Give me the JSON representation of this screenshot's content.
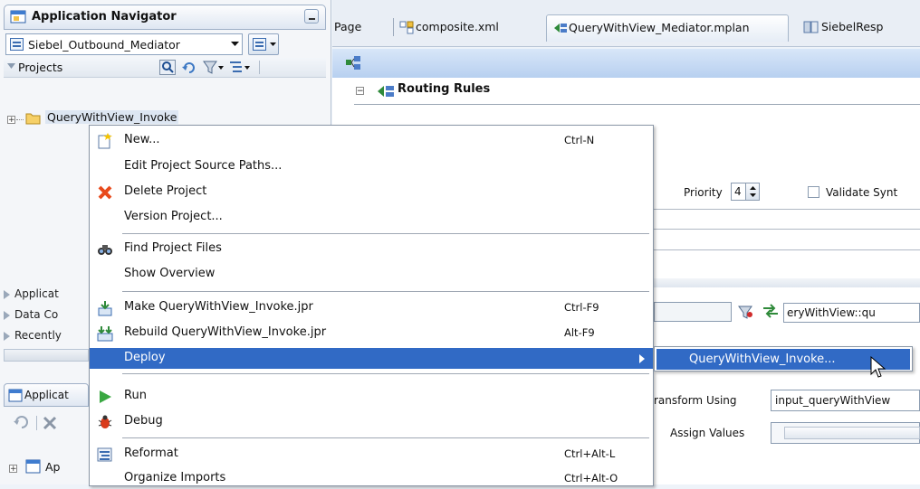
{
  "navigator": {
    "title": "Application Navigator",
    "project_selector": "Siebel_Outbound_Mediator",
    "projects_label": "Projects",
    "tree_item": "QueryWithView_Invoke",
    "accordions": [
      "Applicat",
      "Data Co",
      "Recently"
    ],
    "second_panel_title": "Applicat",
    "second_tree_item": "Ap"
  },
  "tabs": [
    {
      "label": "Page"
    },
    {
      "label": "composite.xml"
    },
    {
      "label": "QueryWithView_Mediator.mplan"
    },
    {
      "label": "SiebelResp"
    }
  ],
  "editor": {
    "routing_rules": "Routing Rules",
    "priority_label": "Priority",
    "priority_value": "4",
    "validate_label": "Validate Synt",
    "filter_value": "eryWithView::qu",
    "transform_label": "ransform Using",
    "transform_value": "input_queryWithView",
    "assign_label": "Assign Values"
  },
  "context_menu": {
    "items": [
      {
        "label": "New...",
        "shortcut": "Ctrl-N",
        "icon": "new-icon"
      },
      {
        "label": "Edit Project Source Paths...",
        "shortcut": "",
        "icon": ""
      },
      {
        "label": "Delete Project",
        "shortcut": "",
        "icon": "delete-icon"
      },
      {
        "label": "Version Project...",
        "shortcut": "",
        "icon": ""
      },
      {
        "label": "Find Project Files",
        "shortcut": "",
        "icon": "binoculars-icon"
      },
      {
        "label": "Show Overview",
        "shortcut": "",
        "icon": ""
      },
      {
        "label": "Make QueryWithView_Invoke.jpr",
        "shortcut": "Ctrl-F9",
        "icon": "make-icon"
      },
      {
        "label": "Rebuild QueryWithView_Invoke.jpr",
        "shortcut": "Alt-F9",
        "icon": "rebuild-icon"
      },
      {
        "label": "Deploy",
        "shortcut": "",
        "icon": ""
      },
      {
        "label": "Run",
        "shortcut": "",
        "icon": "run-icon"
      },
      {
        "label": "Debug",
        "shortcut": "",
        "icon": "debug-icon"
      },
      {
        "label": "Reformat",
        "shortcut": "Ctrl+Alt-L",
        "icon": "reformat-icon"
      },
      {
        "label": "Organize Imports",
        "shortcut": "Ctrl+Alt-O",
        "icon": ""
      }
    ],
    "submenu_item": "QueryWithView_Invoke..."
  },
  "colors": {
    "highlight": "#316ac5",
    "accent_bar": "#b7d0f0"
  }
}
